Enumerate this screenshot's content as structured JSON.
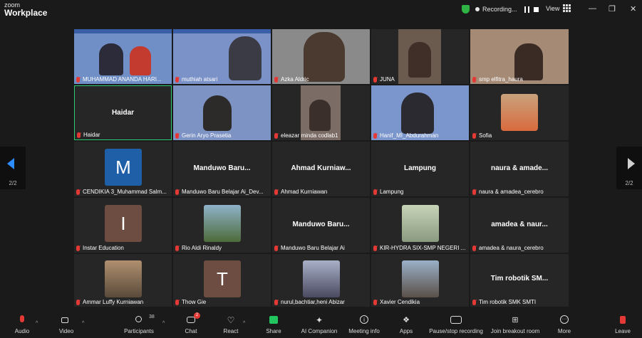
{
  "app": {
    "brand_small": "zoom",
    "brand_large": "Workplace"
  },
  "topbar": {
    "recording_label": "Recording...",
    "view_label": "View"
  },
  "tiles": [
    {
      "name": "MUHAMMAD ANANDA HARI..."
    },
    {
      "name": "muthiah atsari"
    },
    {
      "name": "Azka Aldric"
    },
    {
      "name": "JUNA"
    },
    {
      "name": "smp elfitra_haura"
    },
    {
      "name": "Haidar",
      "center": "Haidar"
    },
    {
      "name": "Gerin Aryo Prasetia"
    },
    {
      "name": "eleazar minda codlab1"
    },
    {
      "name": "Hanif_MI_Abdurahman"
    },
    {
      "name": "Sofia"
    },
    {
      "name": "CENDIKIA 3_Muhammad Salm...",
      "avatar": "M"
    },
    {
      "name": "Manduwo Baru Belajar Ai_Dev...",
      "center": "Manduwo Baru..."
    },
    {
      "name": "Ahmad Kurniawan",
      "center": "Ahmad Kurniaw..."
    },
    {
      "name": "Lampung",
      "center": "Lampung"
    },
    {
      "name": "naura & amadea_cerebro",
      "center": "naura & amade..."
    },
    {
      "name": "Instar Education",
      "avatar": "I"
    },
    {
      "name": "Rio Aldi Rinaldy"
    },
    {
      "name": "Manduwo Baru Belajar Ai",
      "center": "Manduwo Baru..."
    },
    {
      "name": "KIR-HYDRA SIX-SMP NEGERI ..."
    },
    {
      "name": "amadea & naura_cerebro",
      "center": "amadea & naur..."
    },
    {
      "name": "Ammar Luffy Kurniawan"
    },
    {
      "name": "Thow Gie",
      "avatar": "T"
    },
    {
      "name": "nurul,bachtiar,heni Abizar"
    },
    {
      "name": "Xavier Cendikia"
    },
    {
      "name": "Tim robotik SMK SMTI",
      "center": "Tim robotik SM..."
    }
  ],
  "nav": {
    "page_left": "2/2",
    "page_right": "2/2"
  },
  "toolbar": {
    "audio": "Audio",
    "video": "Video",
    "participants": "Participants",
    "participants_count": "38",
    "chat": "Chat",
    "chat_badge": "2",
    "react": "React",
    "share": "Share",
    "ai": "AI Companion",
    "meeting_info": "Meeting info",
    "apps": "Apps",
    "record": "Pause/stop recording",
    "breakout": "Join breakout room",
    "more": "More",
    "leave": "Leave"
  },
  "colors": {
    "accent_blue": "#2d8cff",
    "share_green": "#22c55e",
    "mic_red": "#e53935",
    "active_border": "#2ecc71"
  }
}
